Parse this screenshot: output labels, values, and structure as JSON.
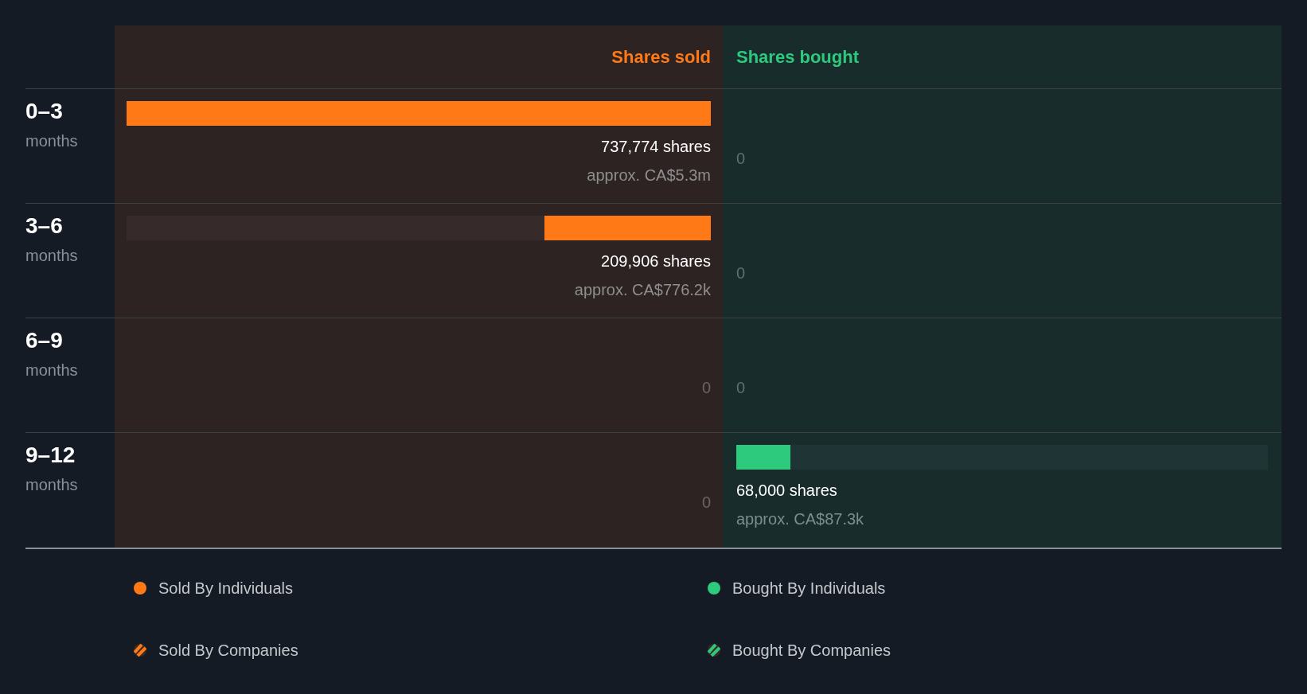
{
  "headers": {
    "sold": "Shares sold",
    "bought": "Shares bought"
  },
  "rows": [
    {
      "period": "0–3",
      "unit": "months",
      "sold": {
        "kind": "bar",
        "level": 1,
        "shares": "737,774 shares",
        "approx": "approx. CA$5.3m"
      },
      "bought": {
        "kind": "zero",
        "text": "0"
      }
    },
    {
      "period": "3–6",
      "unit": "months",
      "sold": {
        "kind": "bar",
        "level": 0.285,
        "shares": "209,906 shares",
        "approx": "approx. CA$776.2k"
      },
      "bought": {
        "kind": "zero",
        "text": "0"
      }
    },
    {
      "period": "6–9",
      "unit": "months",
      "sold": {
        "kind": "zero",
        "text": "0"
      },
      "bought": {
        "kind": "zero",
        "text": "0"
      }
    },
    {
      "period": "9–12",
      "unit": "months",
      "sold": {
        "kind": "zero",
        "text": "0"
      },
      "bought": {
        "kind": "bar",
        "level": 0.102,
        "shares": "68,000 shares",
        "approx": "approx. CA$87.3k"
      }
    }
  ],
  "legend": [
    {
      "label": "Sold By Individuals",
      "kind": "dot",
      "color": "#ff7a16"
    },
    {
      "label": "Bought By Individuals",
      "kind": "dot",
      "color": "#2dca7e"
    },
    {
      "label": "Sold By Companies",
      "kind": "striped",
      "color": "#ff7a16"
    },
    {
      "label": "Bought By Companies",
      "kind": "striped",
      "color": "#2dca7e"
    }
  ]
}
